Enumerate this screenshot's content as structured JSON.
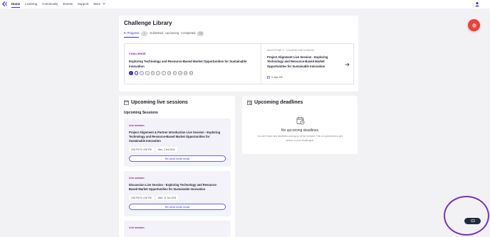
{
  "nav": {
    "items": [
      {
        "label": "Home",
        "active": true
      },
      {
        "label": "Learning",
        "active": false
      },
      {
        "label": "Community",
        "active": false
      },
      {
        "label": "Events",
        "active": false
      },
      {
        "label": "Support",
        "active": false
      },
      {
        "label": "More",
        "active": false
      }
    ],
    "more_icon": "chevron-down-icon",
    "logo_icon": "brand-logo-icon",
    "user_icon": "user-icon"
  },
  "library": {
    "title": "Challenge Library",
    "tabs": [
      {
        "label": "In Progress",
        "count": "1",
        "active": true
      },
      {
        "label": "Submitted",
        "count": "",
        "active": false
      },
      {
        "label": "Upcoming",
        "count": "",
        "active": false
      },
      {
        "label": "Completed",
        "count": "18",
        "active": false
      }
    ],
    "challenge": {
      "type_label": "CHALLENGE",
      "title": "Exploring Technology and Resource-Based Market Opportunities for Sustainable Innovation",
      "milestones": [
        "✓",
        "2",
        "3",
        "4",
        "5",
        "6",
        "7",
        "8",
        "9",
        "10",
        "11",
        "12"
      ],
      "milestone_current": 2,
      "milestone_label": "MILESTONE 2 · COURSE DISCUSSION",
      "milestone_title": "Project Alignment Live Session - Exploring Technology and Resource-Based Market Opportunities for Sustainable Innovation",
      "days_left": "5 days left"
    }
  },
  "live": {
    "title": "Upcoming live sessions",
    "subtitle": "Upcoming Sessions",
    "sessions": [
      {
        "type": "Live session",
        "title": "Project Alignment & Partner Introduction Live Session - Exploring Technology and Resource-Based Market Opportunities for Sustainable Innovation",
        "time": "3:00 PM To 4:00 PM",
        "date": "Mon, 3 Jun 2024",
        "action": "Re-send invite email"
      },
      {
        "type": "Live session",
        "title": "Discussion Live Session - Exploring Technology and Resource- Based Market Opportunities for Sustainable Innovation",
        "time": "3:30 PM To 4:30 PM",
        "date": "Wed, 11 Jun 2024",
        "action": "Re-send invite email"
      },
      {
        "type": "Live session"
      }
    ]
  },
  "deadlines": {
    "title": "Upcoming deadlines",
    "empty_title": "No upcoming deadlines",
    "empty_text": "You don't have any deadlines coming up at the moment. This is a great time to get ahead on your challenges!"
  },
  "colors": {
    "accent": "#3a2fd0",
    "type_label": "#7a1fa2",
    "fab": "#e8443a",
    "help_ring": "#7b2fbf"
  }
}
